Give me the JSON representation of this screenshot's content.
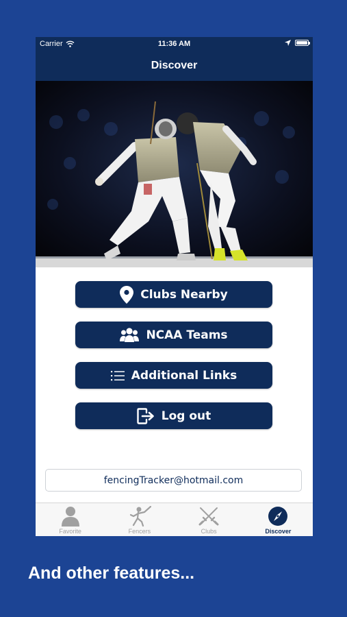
{
  "status_bar": {
    "carrier": "Carrier",
    "time": "11:36 AM"
  },
  "nav": {
    "title": "Discover"
  },
  "hero": {
    "image_alt": "Two fencers in a foil bout on a piste"
  },
  "menu": {
    "buttons": [
      {
        "label": "Clubs Nearby",
        "icon": "map-pin-icon"
      },
      {
        "label": "NCAA Teams",
        "icon": "group-icon"
      },
      {
        "label": "Additional Links",
        "icon": "list-icon"
      },
      {
        "label": "Log out",
        "icon": "logout-icon"
      }
    ]
  },
  "contact": {
    "email": "fencingTracker@hotmail.com"
  },
  "tabs": [
    {
      "label": "Favorite",
      "icon": "person-icon",
      "active": false
    },
    {
      "label": "Fencers",
      "icon": "fencer-icon",
      "active": false
    },
    {
      "label": "Clubs",
      "icon": "crossed-swords-icon",
      "active": false
    },
    {
      "label": "Discover",
      "icon": "compass-icon",
      "active": true
    }
  ],
  "caption": "And other features...",
  "colors": {
    "background": "#1c4494",
    "navy": "#0f2c5a",
    "inactive_tab": "#a0a0a0"
  }
}
